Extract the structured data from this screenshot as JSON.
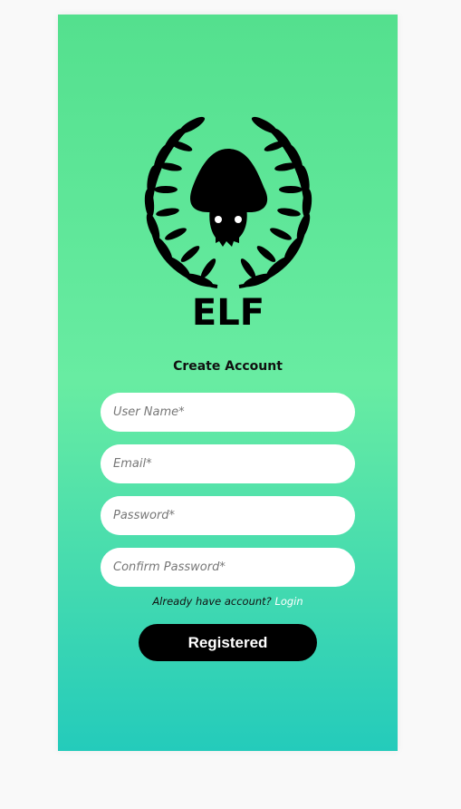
{
  "logo": {
    "icon": "elf-mushroom-laurel-logo",
    "text": "ELF"
  },
  "form": {
    "title": "Create Account",
    "fields": [
      {
        "placeholder": "User Name*",
        "value": ""
      },
      {
        "placeholder": "Email*",
        "value": ""
      },
      {
        "placeholder": "Password*",
        "value": ""
      },
      {
        "placeholder": "Confirm Password*",
        "value": ""
      }
    ],
    "account_prompt": "Already have account?",
    "login_link": "Login",
    "submit_label": "Registered"
  },
  "colors": {
    "gradient_top": "#54e08e",
    "gradient_mid": "#68eca2",
    "gradient_bottom": "#24cbbb",
    "button": "#000000",
    "link": "#ffffff"
  }
}
